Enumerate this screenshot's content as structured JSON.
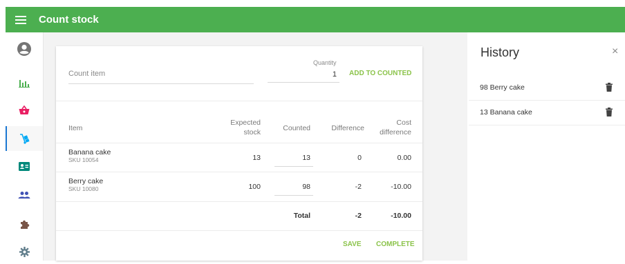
{
  "app": {
    "title": "Count stock",
    "accent": "#4caf50",
    "action_color": "#8bc34a"
  },
  "sidebar": {
    "items": [
      {
        "icon": "account-icon"
      },
      {
        "icon": "bar-chart-icon"
      },
      {
        "icon": "basket-icon"
      },
      {
        "icon": "dolly-icon",
        "active": true
      },
      {
        "icon": "contact-card-icon"
      },
      {
        "icon": "people-icon"
      },
      {
        "icon": "puzzle-icon"
      },
      {
        "icon": "gear-icon"
      }
    ]
  },
  "count_form": {
    "item_placeholder": "Count item",
    "quantity_label": "Quantity",
    "quantity_value": "1",
    "add_label": "ADD TO COUNTED"
  },
  "table": {
    "headers": {
      "item": "Item",
      "expected_line1": "Expected",
      "expected_line2": "stock",
      "counted": "Counted",
      "difference": "Difference",
      "cost_line1": "Cost",
      "cost_line2": "difference"
    },
    "rows": [
      {
        "name": "Banana cake",
        "sku": "SKU 10054",
        "expected": "13",
        "counted": "13",
        "difference": "0",
        "cost": "0.00"
      },
      {
        "name": "Berry cake",
        "sku": "SKU 10080",
        "expected": "100",
        "counted": "98",
        "difference": "-2",
        "cost": "-10.00"
      }
    ],
    "total": {
      "label": "Total",
      "difference": "-2",
      "cost": "-10.00"
    }
  },
  "actions": {
    "save": "SAVE",
    "complete": "COMPLETE"
  },
  "history": {
    "title": "History",
    "close": "×",
    "items": [
      {
        "label": "98 Berry cake"
      },
      {
        "label": "13 Banana cake"
      }
    ]
  }
}
